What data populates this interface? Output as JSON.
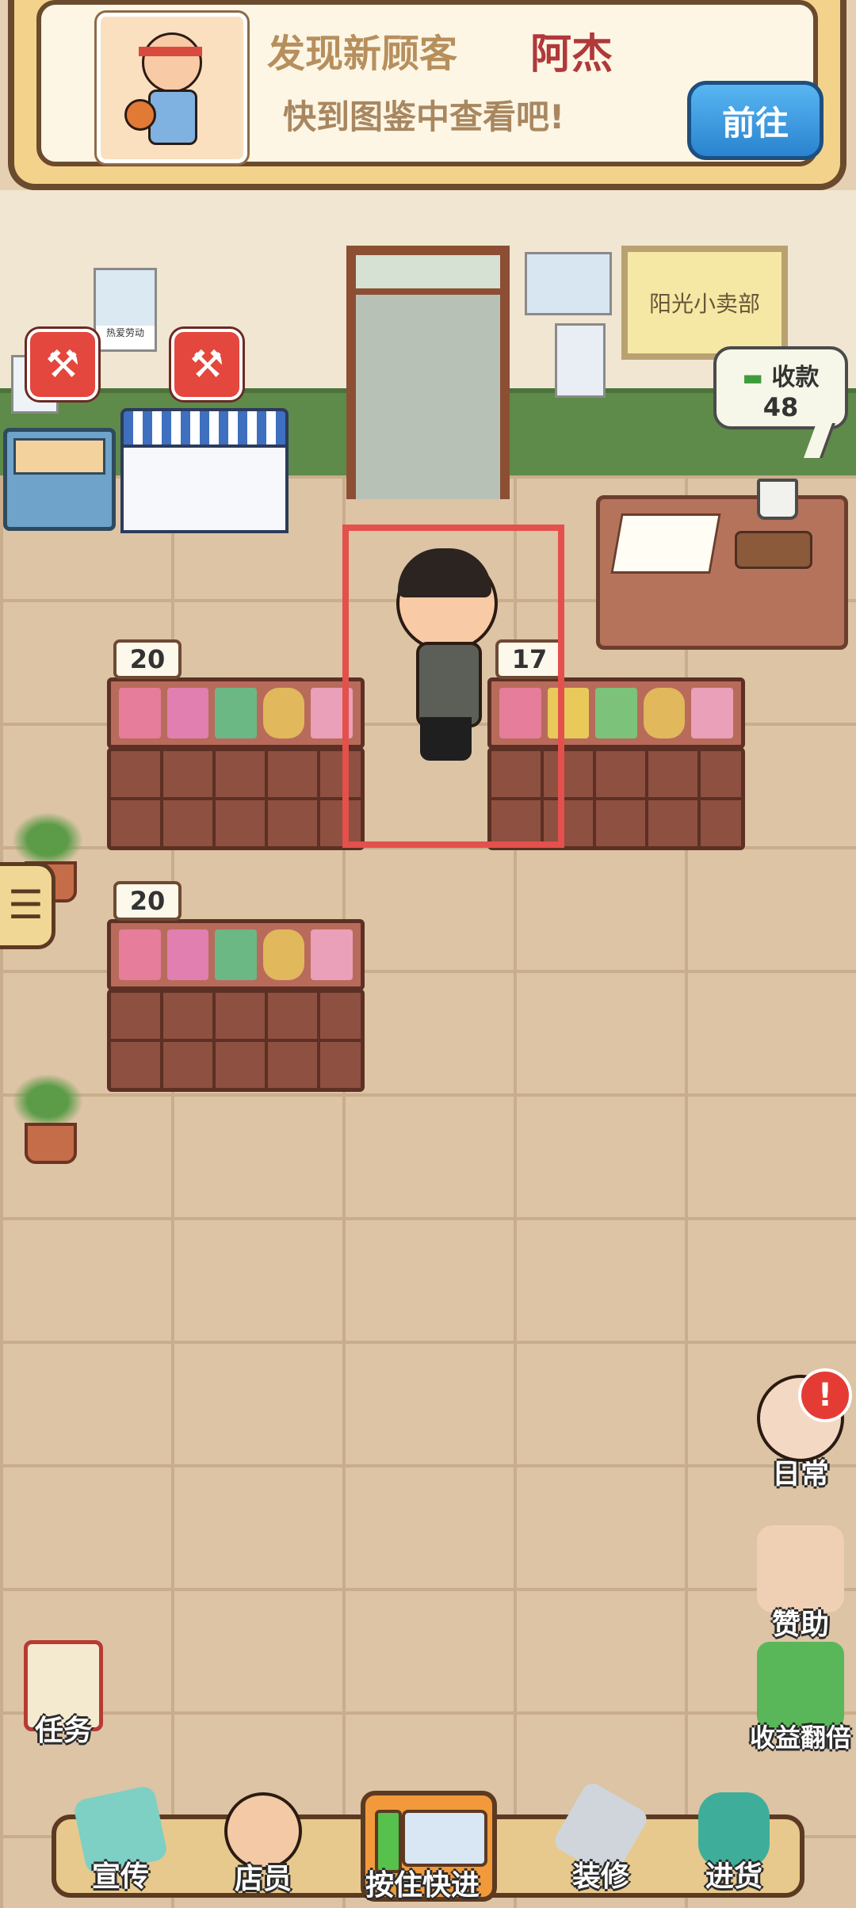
{
  "notification": {
    "title": "发现新顾客",
    "customer_name": "阿杰",
    "subtitle": "快到图鉴中查看吧!",
    "goto_button": "前往"
  },
  "wall": {
    "shop_sign": "阳光小卖部",
    "poster_label": "热爱劳动"
  },
  "cashier": {
    "label": "收款",
    "amount": "48"
  },
  "shelves": [
    {
      "price": "20"
    },
    {
      "price": "17"
    },
    {
      "price": "20"
    }
  ],
  "side_buttons": {
    "daily": "日常",
    "sponsor": "赞助",
    "double_income": "收益翻倍",
    "task": "任务"
  },
  "bottom_nav": {
    "promote": "宣传",
    "staff": "店员",
    "fast_forward": "按住快进",
    "renovate": "装修",
    "restock": "进货"
  },
  "icons": {
    "menu": "hamburger-icon",
    "repair": "wrench-hammer-icon",
    "alert": "exclamation-icon"
  },
  "colors": {
    "highlight": "#e4504c",
    "customer_name": "#b0393a",
    "goto_button": "#2a83cf"
  }
}
